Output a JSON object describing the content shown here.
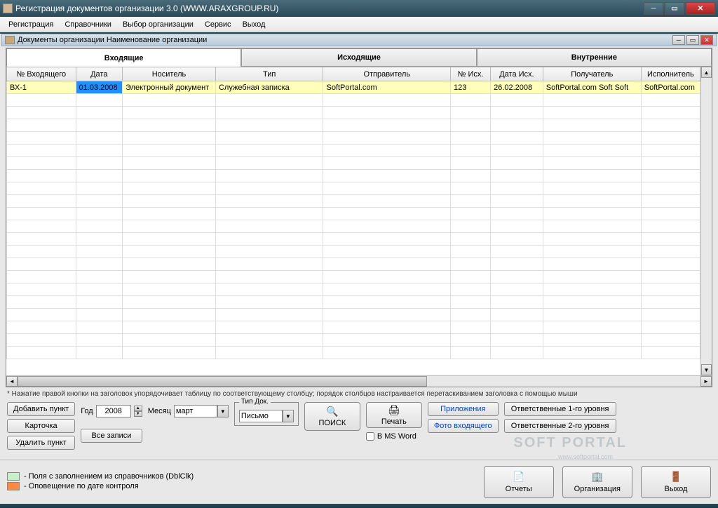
{
  "window": {
    "title": "Регистрация документов организации 3.0 (WWW.ARAXGROUP.RU)"
  },
  "menu": {
    "items": [
      "Регистрация",
      "Справочники",
      "Выбор организации",
      "Сервис",
      "Выход"
    ]
  },
  "mdi": {
    "title": "Документы организации Наименование организации"
  },
  "tabs": {
    "items": [
      "Входящие",
      "Исходящие",
      "Внутренние"
    ],
    "active": 0
  },
  "grid": {
    "columns": [
      "№ Входящего",
      "Дата",
      "Носитель",
      "Тип",
      "Отправитель",
      "№ Исх.",
      "Дата Исх.",
      "Получатель",
      "Исполнитель"
    ],
    "rows": [
      {
        "num": "ВХ-1",
        "date": "01.03.2008",
        "carrier": "Электронный документ",
        "type": "Служебная записка",
        "sender": "SoftPortal.com",
        "out_num": "123",
        "out_date": "26.02.2008",
        "recipient": "SoftPortal.com Soft Soft",
        "executor": "SoftPortal.com"
      }
    ]
  },
  "hint": "* Нажатие правой кнопки на заголовок упорядочивает таблицу по соответствующему  столбцу;  порядок столбцов настраивается перетаскиванием заголовка с помощью мыши",
  "controls": {
    "add": "Добавить пункт",
    "card": "Карточка",
    "delete": "Удалить пункт",
    "year_label": "Год",
    "year_value": "2008",
    "month_label": "Месяц",
    "month_value": "март",
    "all_records": "Все записи",
    "doc_type_label": "Тип Док.",
    "doc_type_value": "Письмо",
    "search": "ПОИСК",
    "print": "Печать",
    "msword": "В MS Word",
    "attachments": "Приложения",
    "photo": "Фото входящего",
    "resp1": "Ответственные 1-го уровня",
    "resp2": "Ответственные 2-го уровня"
  },
  "legend": {
    "green": "- Поля с заполнением из справочников (DblClk)",
    "orange": "- Оповещение по дате контроля"
  },
  "footer": {
    "reports": "Отчеты",
    "organization": "Организация",
    "exit": "Выход"
  },
  "watermark": {
    "main": "SOFT PORTAL",
    "sub": "www.softportal.com"
  }
}
